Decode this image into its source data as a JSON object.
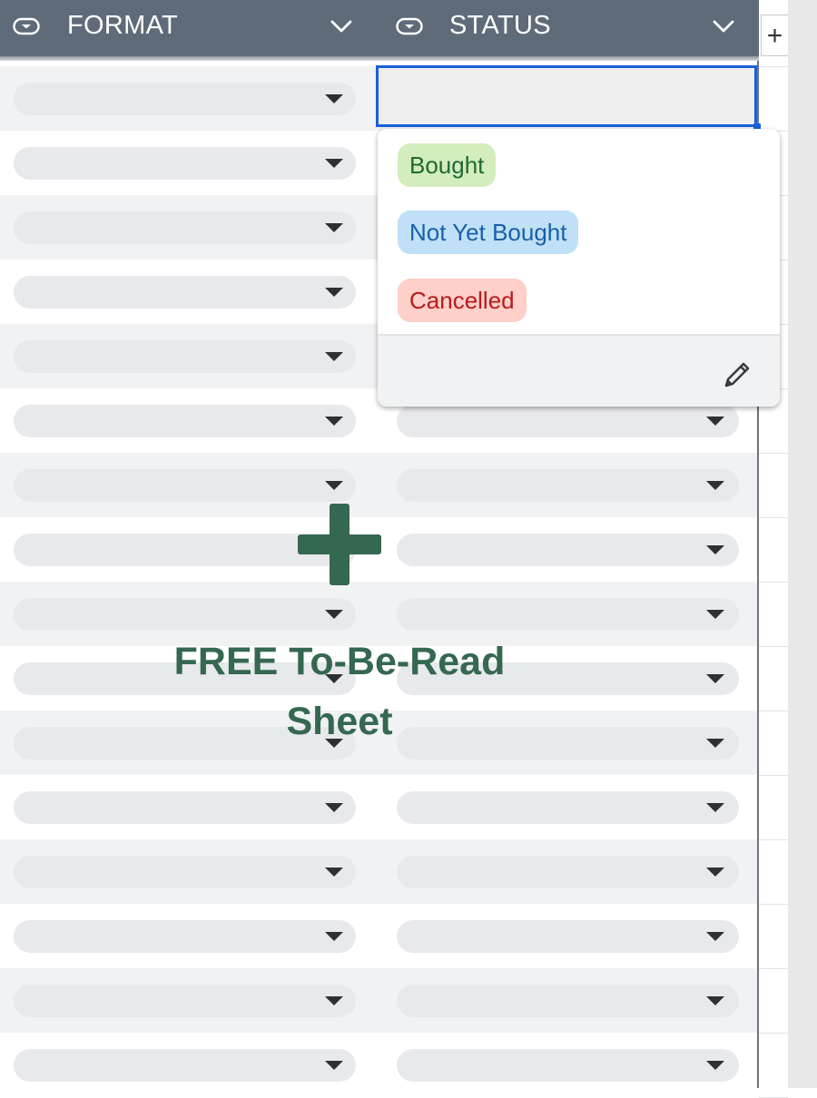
{
  "header": {
    "columns": [
      {
        "label": "FORMAT"
      },
      {
        "label": "STATUS"
      }
    ],
    "add_column_label": "+"
  },
  "dropdown": {
    "options": [
      {
        "label": "Bought",
        "bg": "#d4edbc",
        "fg": "#1e6b32"
      },
      {
        "label": "Not Yet Bought",
        "bg": "#bfe0f6",
        "fg": "#1a5fa8"
      },
      {
        "label": "Cancelled",
        "bg": "#ffcfc9",
        "fg": "#b71c1c"
      }
    ]
  },
  "promo": {
    "line1": "FREE To-Be-Read",
    "line2": "Sheet"
  },
  "colors": {
    "header_bg": "#5f6b78",
    "selection": "#1a5fd6",
    "promo_green": "#356850",
    "chip_bg": "#e8e9ec"
  }
}
